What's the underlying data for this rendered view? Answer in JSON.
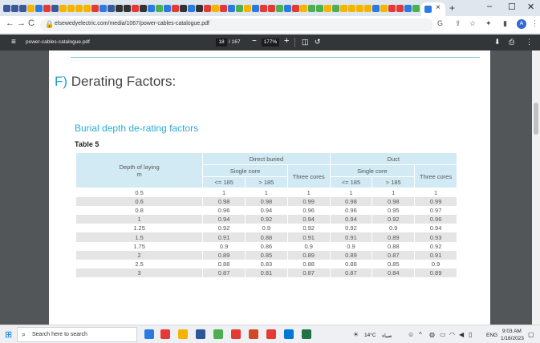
{
  "browser": {
    "tab_favicon_colors": [
      "#3b5998",
      "#3b5998",
      "#3b5998",
      "#f4b400",
      "#2a7ae2",
      "#e53935",
      "#3b5998",
      "#f4b400",
      "#f4b400",
      "#f4b400",
      "#f4b400",
      "#e53935",
      "#2a7ae2",
      "#3b5998",
      "#333333",
      "#333333",
      "#e53935",
      "#333333",
      "#2a7ae2",
      "#4caf50",
      "#2a7ae2",
      "#e53935",
      "#333333",
      "#2a7ae2",
      "#333333",
      "#e53935",
      "#f4b400",
      "#e53935",
      "#2a7ae2",
      "#4caf50",
      "#f4b400",
      "#2a7ae2",
      "#e53935",
      "#e53935",
      "#4caf50",
      "#2a7ae2",
      "#e53935",
      "#f4b400",
      "#4caf50",
      "#4caf50",
      "#f4b400",
      "#4caf50",
      "#f4b400",
      "#f4b400",
      "#f4b400",
      "#f4b400",
      "#2a7ae2",
      "#f4b400",
      "#e53935",
      "#e53935",
      "#2a7ae2",
      "#4caf50",
      "#e53935"
    ],
    "active_tab_close": "×",
    "new_tab": "+",
    "window_controls": {
      "minimize": "–",
      "maximize": "☐",
      "close": "✕"
    },
    "nav": {
      "back": "←",
      "forward": "→",
      "reload": "C"
    },
    "url": "elsewedyelectric.com/media/1067/power-cables-catalogue.pdf",
    "profile_initial": "A"
  },
  "pdf_toolbar": {
    "menu_icon": "≡",
    "filename": "power-cables-catalogue.pdf",
    "current_page": "18",
    "total_pages": "/ 167",
    "zoom_out": "−",
    "zoom": "177%",
    "zoom_in": "+",
    "download_icon": "⬇",
    "print_icon": "⎙",
    "more_icon": "⋮"
  },
  "document": {
    "section_letter": "F)",
    "section_title": "Derating Factors:",
    "subheading": "Burial depth de-rating factors",
    "table_title": "Table 5",
    "table": {
      "header_depth_line1": "Depth of laying",
      "header_depth_line2": "m",
      "group_direct": "Direct buried",
      "group_duct": "Duct",
      "single_core": "Single core",
      "three_cores": "Three cores",
      "le185": "<= 185",
      "gt185": "> 185",
      "rows": [
        [
          "0.5",
          "1",
          "1",
          "1",
          "1",
          "1",
          "1"
        ],
        [
          "0.6",
          "0.98",
          "0.98",
          "0.99",
          "0.98",
          "0.98",
          "0.99"
        ],
        [
          "0.8",
          "0.96",
          "0.94",
          "0.96",
          "0.96",
          "0.95",
          "0.97"
        ],
        [
          "1",
          "0.94",
          "0.92",
          "0.94",
          "0.94",
          "0.92",
          "0.96"
        ],
        [
          "1.25",
          "0.92",
          "0.9",
          "0.92",
          "0.92",
          "0.9",
          "0.94"
        ],
        [
          "1.5",
          "0.91",
          "0.88",
          "0.91",
          "0.91",
          "0.89",
          "0.93"
        ],
        [
          "1.75",
          "0.9",
          "0.86",
          "0.9",
          "0.9",
          "0.88",
          "0.92"
        ],
        [
          "2",
          "0.89",
          "0.85",
          "0.89",
          "0.89",
          "0.87",
          "0.91"
        ],
        [
          "2.5",
          "0.88",
          "0.83",
          "0.88",
          "0.88",
          "0.85",
          "0.9"
        ],
        [
          "3",
          "0.87",
          "0.81",
          "0.87",
          "0.87",
          "0.84",
          "0.89"
        ]
      ]
    }
  },
  "taskbar": {
    "search_placeholder": "Search here to search",
    "apps": [
      {
        "name": "file-explorer",
        "color": "#2a7ae2"
      },
      {
        "name": "chrome",
        "color": "#e53935"
      },
      {
        "name": "file-manager",
        "color": "#f4b400"
      },
      {
        "name": "word",
        "color": "#2b579a"
      },
      {
        "name": "chrome-2",
        "color": "#4caf50"
      },
      {
        "name": "chrome-3",
        "color": "#e53935"
      },
      {
        "name": "powerpoint",
        "color": "#d24726"
      },
      {
        "name": "acrobat",
        "color": "#e53935"
      },
      {
        "name": "outlook",
        "color": "#0078d4"
      },
      {
        "name": "excel",
        "color": "#217346"
      }
    ],
    "weather": "14°C",
    "weather_label": "صباء",
    "language": "ENG",
    "time": "9:03 AM",
    "date": "1/16/2023"
  }
}
